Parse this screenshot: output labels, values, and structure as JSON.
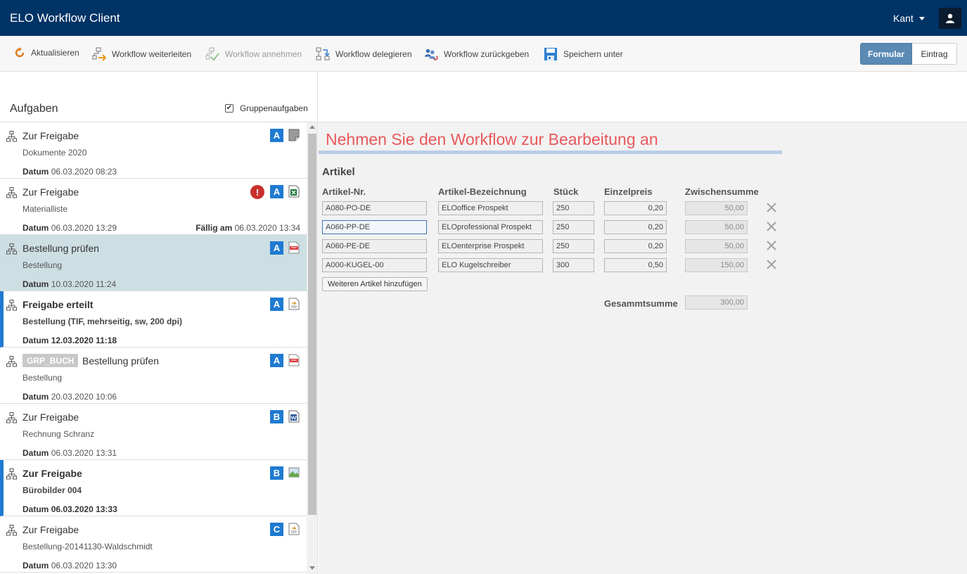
{
  "header": {
    "app_title": "ELO Workflow Client",
    "user_name": "Kant"
  },
  "toolbar": {
    "items": [
      {
        "label": "Aktualisieren",
        "icon": "refresh-icon",
        "enabled": true
      },
      {
        "label": "Workflow weiterleiten",
        "icon": "forward-workflow-icon",
        "enabled": true
      },
      {
        "label": "Workflow annehmen",
        "icon": "accept-workflow-icon",
        "enabled": false
      },
      {
        "label": "Workflow delegieren",
        "icon": "delegate-workflow-icon",
        "enabled": true
      },
      {
        "label": "Workflow zurückgeben",
        "icon": "return-workflow-icon",
        "enabled": true
      },
      {
        "label": "Speichern unter",
        "icon": "save-icon",
        "enabled": true
      }
    ],
    "view_toggle": {
      "formular": "Formular",
      "eintrag": "Eintrag",
      "active": "Formular"
    }
  },
  "tasks_panel": {
    "title": "Aufgaben",
    "group_tasks_label": "Gruppenaufgaben",
    "group_tasks_checked": true,
    "date_label": "Datum",
    "due_label": "Fällig am",
    "tasks": [
      {
        "title": "Zur Freigabe",
        "subtitle": "Dokumente 2020",
        "date": "06.03.2020 08:23",
        "badge": "A",
        "doc_type": "generic-document-icon"
      },
      {
        "title": "Zur Freigabe",
        "subtitle": "Materialliste",
        "date": "06.03.2020 13:29",
        "due": "06.03.2020 13:34",
        "badge": "A",
        "doc_type": "excel-file-icon",
        "alert": "!"
      },
      {
        "title": "Bestellung prüfen",
        "subtitle": "Bestellung",
        "date": "10.03.2020 11:24",
        "badge": "A",
        "doc_type": "pdf-file-icon",
        "selected": true
      },
      {
        "title": "Freigabe erteilt",
        "subtitle": "Bestellung (TIF, mehrseitig, sw, 200 dpi)",
        "date": "12.03.2020 11:18",
        "badge": "A",
        "doc_type": "tif-file-icon",
        "unread": true
      },
      {
        "group": "GRP_BUCH",
        "title": "Bestellung prüfen",
        "subtitle": "Bestellung",
        "date": "20.03.2020 10:06",
        "badge": "A",
        "doc_type": "pdf-file-icon"
      },
      {
        "title": "Zur Freigabe",
        "subtitle": "Rechnung Schranz",
        "date": "06.03.2020 13:31",
        "badge": "B",
        "doc_type": "word-file-icon"
      },
      {
        "title": "Zur Freigabe",
        "subtitle": "Bürobilder 004",
        "date": "06.03.2020 13:33",
        "badge": "B",
        "doc_type": "image-file-icon",
        "unread": true
      },
      {
        "title": "Zur Freigabe",
        "subtitle": "Bestellung-20141130-Waldschmidt",
        "date": "06.03.2020 13:30",
        "badge": "C",
        "doc_type": "tif-file-icon"
      }
    ]
  },
  "form": {
    "heading": "Nehmen Sie den Workflow zur Bearbeitung an",
    "section_title": "Artikel",
    "columns": [
      "Artikel-Nr.",
      "Artikel-Bezeichnung",
      "Stück",
      "Einzelpreis",
      "Zwischensumme"
    ],
    "rows": [
      {
        "nr": "A080-PO-DE",
        "name": "ELOoffice Prospekt",
        "qty": "250",
        "price": "0,20",
        "subtotal": "50,00"
      },
      {
        "nr": "A060-PP-DE",
        "name": "ELOprofessional Prospekt",
        "qty": "250",
        "price": "0,20",
        "subtotal": "50,00"
      },
      {
        "nr": "A060-PE-DE",
        "name": "ELOenterprise Prospekt",
        "qty": "250",
        "price": "0,20",
        "subtotal": "50,00"
      },
      {
        "nr": "A000-KUGEL-00",
        "name": "ELO Kugelschreiber",
        "qty": "300",
        "price": "0,50",
        "subtotal": "150,00"
      }
    ],
    "add_button": "Weiteren Artikel hinzufügen",
    "total_label": "Gesammtsumme",
    "total_value": "300,00"
  }
}
